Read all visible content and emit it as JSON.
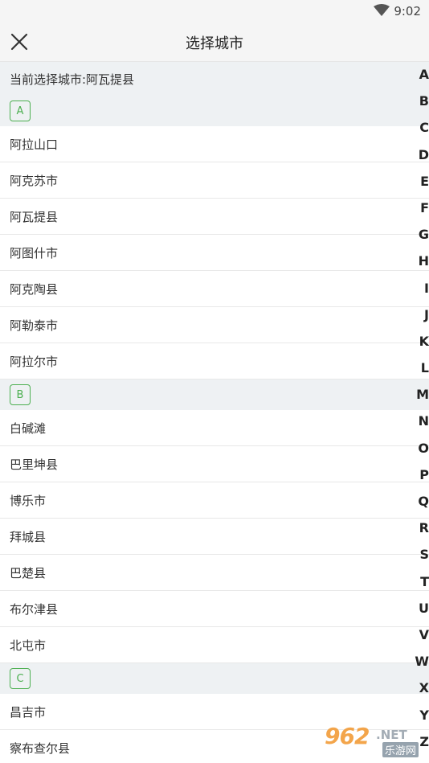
{
  "status": {
    "time": "9:02"
  },
  "header": {
    "title": "选择城市"
  },
  "current_city": {
    "text": "当前选择城市:阿瓦提县"
  },
  "sections": [
    {
      "letter": "A",
      "cities": [
        "阿拉山口",
        "阿克苏市",
        "阿瓦提县",
        "阿图什市",
        "阿克陶县",
        "阿勒泰市",
        "阿拉尔市"
      ]
    },
    {
      "letter": "B",
      "cities": [
        "白碱滩",
        "巴里坤县",
        "博乐市",
        "拜城县",
        "巴楚县",
        "布尔津县",
        "北屯市"
      ]
    },
    {
      "letter": "C",
      "cities": [
        "昌吉市",
        "察布查尔县"
      ]
    }
  ],
  "index_letters": [
    "A",
    "B",
    "C",
    "D",
    "E",
    "F",
    "G",
    "H",
    "I",
    "J",
    "K",
    "L",
    "M",
    "N",
    "O",
    "P",
    "Q",
    "R",
    "S",
    "T",
    "U",
    "V",
    "W",
    "X",
    "Y",
    "Z"
  ],
  "watermark": {
    "number": "962",
    "suffix": ".NET",
    "sub": "乐游网"
  },
  "colors": {
    "accent": "#4caf50",
    "section_bg": "#eef1f3",
    "toolbar_bg": "#f5f5f5"
  }
}
